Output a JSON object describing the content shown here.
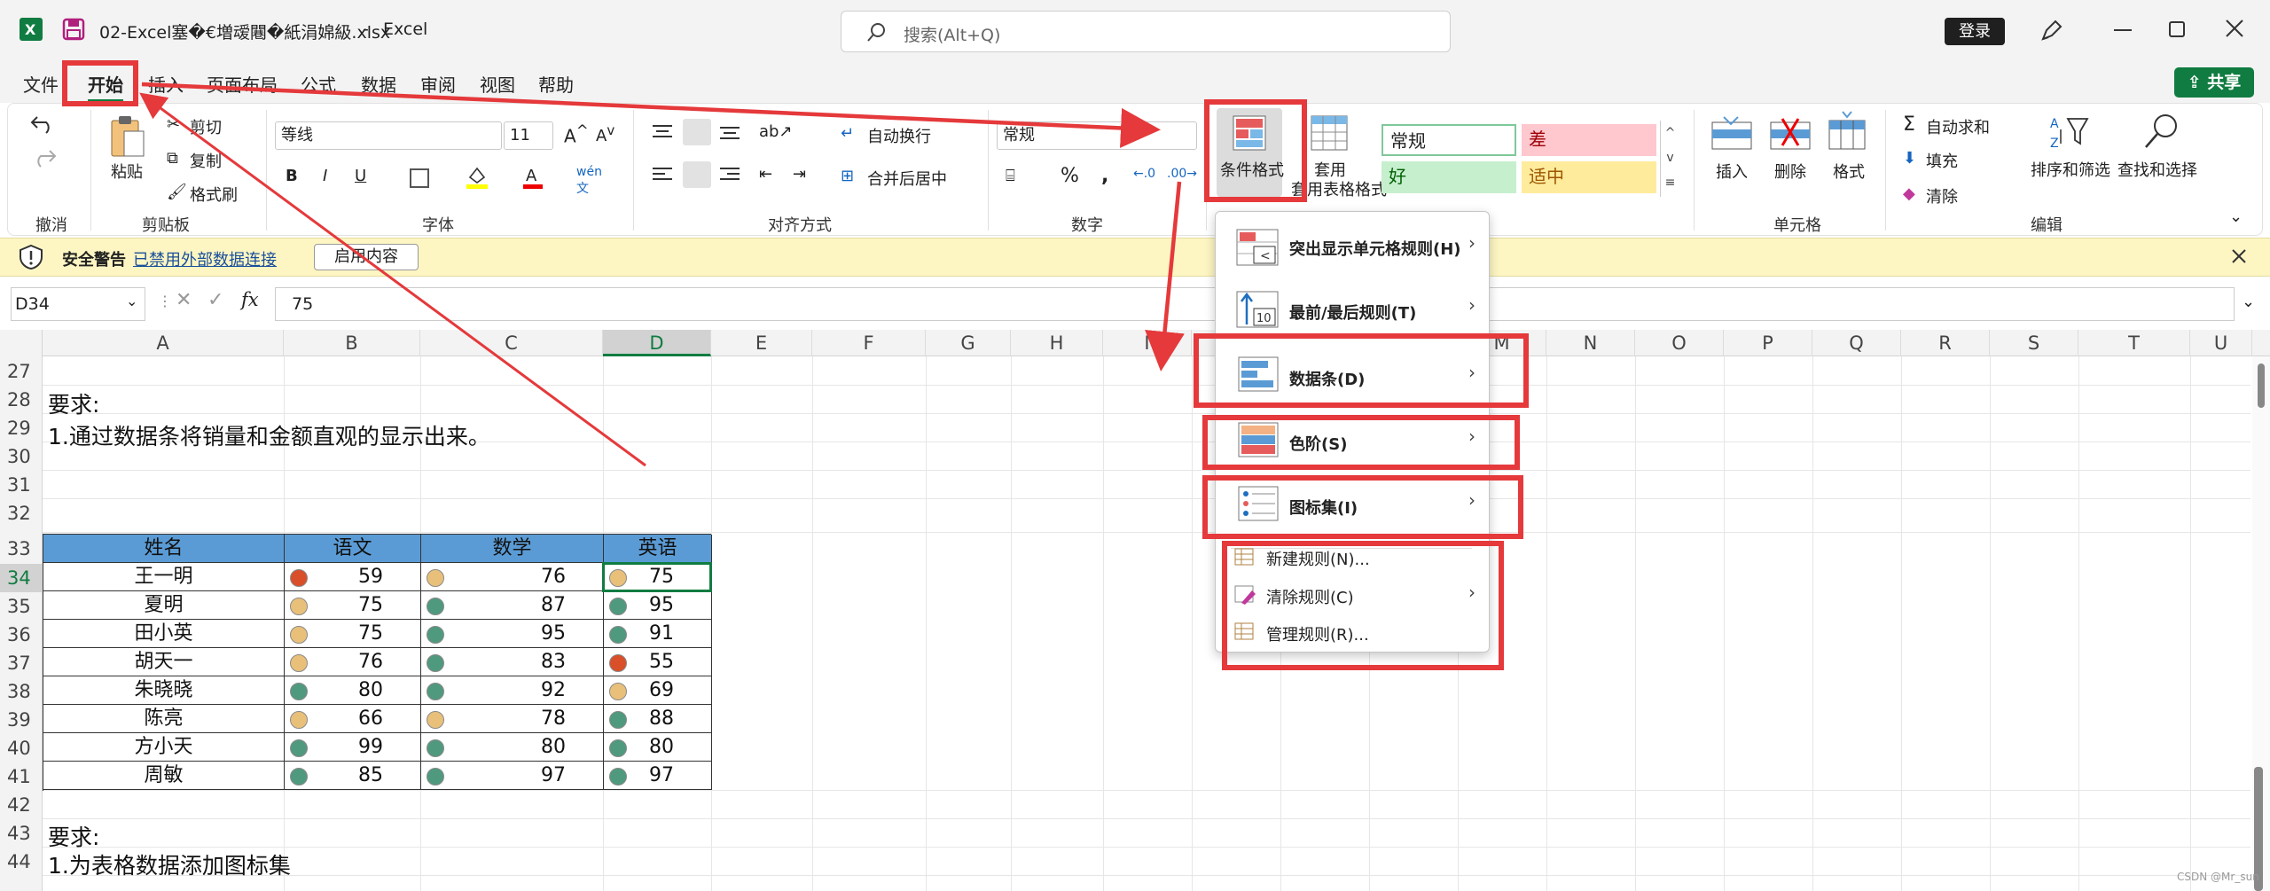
{
  "title_bar": {
    "filename": "02-Excel塞�€増叆闀�紙涓婂級.xlsx",
    "app": "Excel",
    "search_placeholder": "搜索(Alt+Q)",
    "login_label": "登录",
    "separator": "-"
  },
  "menu": {
    "tabs": [
      "文件",
      "开始",
      "插入",
      "页面布局",
      "公式",
      "数据",
      "审阅",
      "视图",
      "帮助"
    ],
    "active_tab": "开始",
    "share_label": "共享"
  },
  "ribbon": {
    "undo_group": "撤消",
    "clipboard": {
      "group": "剪贴板",
      "paste": "粘贴",
      "cut": "剪切",
      "copy": "复制",
      "format_painter": "格式刷"
    },
    "font": {
      "group": "字体",
      "font_name": "等线",
      "font_size": "11"
    },
    "alignment": {
      "group": "对齐方式",
      "wrap": "自动换行",
      "merge": "合并后居中"
    },
    "number": {
      "group": "数字",
      "format": "常规"
    },
    "styles": {
      "conditional_format": "条件格式",
      "format_table": "套用表格格式",
      "normal": "常规",
      "bad": "差",
      "good": "好",
      "neutral": "适中"
    },
    "cells": {
      "group": "单元格",
      "insert": "插入",
      "delete": "删除",
      "format": "格式"
    },
    "editing": {
      "group": "编辑",
      "autosum": "自动求和",
      "fill": "填充",
      "clear": "清除",
      "sort_filter": "排序和筛选",
      "find_select": "查找和选择"
    }
  },
  "security_bar": {
    "title": "安全警告",
    "message": "已禁用外部数据连接",
    "button": "启用内容"
  },
  "formula_bar": {
    "cell_ref": "D34",
    "value": "75"
  },
  "columns": [
    "A",
    "B",
    "C",
    "D",
    "E",
    "F",
    "G",
    "H",
    "I",
    "J",
    "K",
    "L",
    "M",
    "N",
    "O",
    "P",
    "Q",
    "R",
    "S",
    "T",
    "U"
  ],
  "selected_column": "D",
  "rows": [
    "27",
    "28",
    "29",
    "30",
    "31",
    "32",
    "33",
    "34",
    "35",
    "36",
    "37",
    "38",
    "39",
    "40",
    "41",
    "42",
    "43",
    "44"
  ],
  "sheet_text": {
    "req1_title": "要求:",
    "req1_body": "1.通过数据条将销量和金额直观的显示出来。",
    "req2_title": "要求:",
    "req2_body": "1.为表格数据添加图标集"
  },
  "table": {
    "headers": [
      "姓名",
      "语文",
      "数学",
      "英语"
    ],
    "rows": [
      {
        "name": "王一明",
        "chinese": "59",
        "math": "76",
        "english": "75"
      },
      {
        "name": "夏明",
        "chinese": "75",
        "math": "87",
        "english": "95"
      },
      {
        "name": "田小英",
        "chinese": "75",
        "math": "95",
        "english": "91"
      },
      {
        "name": "胡天一",
        "chinese": "76",
        "math": "83",
        "english": "55"
      },
      {
        "name": "朱晓晓",
        "chinese": "80",
        "math": "92",
        "english": "69"
      },
      {
        "name": "陈亮",
        "chinese": "66",
        "math": "78",
        "english": "88"
      },
      {
        "name": "方小天",
        "chinese": "99",
        "math": "80",
        "english": "80"
      },
      {
        "name": "周敏",
        "chinese": "85",
        "math": "97",
        "english": "97"
      }
    ]
  },
  "cf_menu": {
    "items": [
      {
        "label": "突出显示单元格规则(H)",
        "key": "highlight"
      },
      {
        "label": "最前/最后规则(T)",
        "key": "topbottom"
      },
      {
        "label": "数据条(D)",
        "key": "databar"
      },
      {
        "label": "色阶(S)",
        "key": "colorscale"
      },
      {
        "label": "图标集(I)",
        "key": "iconset"
      },
      {
        "label": "新建规则(N)...",
        "key": "new"
      },
      {
        "label": "清除规则(C)",
        "key": "clear"
      },
      {
        "label": "管理规则(R)...",
        "key": "manage"
      }
    ]
  },
  "watermark": "CSDN @Mr_sun",
  "colors": {
    "header_blue": "#5b9bd5",
    "icon_red": "#d94f2a",
    "icon_yellow": "#e8c07a",
    "icon_green": "#4f9a7e",
    "annotation_red": "#e5393b",
    "excel_green": "#107c41"
  }
}
